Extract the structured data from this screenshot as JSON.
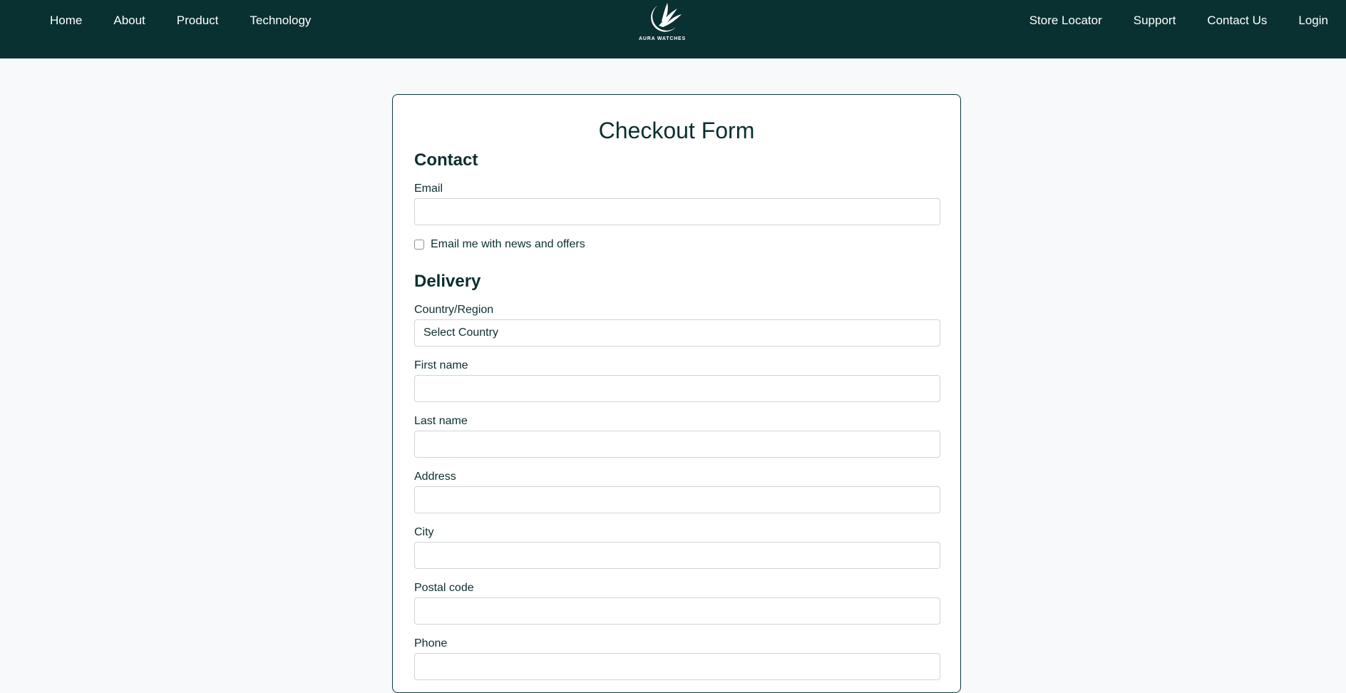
{
  "nav": {
    "left_links": [
      "Home",
      "About",
      "Product",
      "Technology"
    ],
    "right_links": [
      "Store Locator",
      "Support",
      "Contact Us",
      "Login"
    ],
    "logo_text": "AURA WATCHES"
  },
  "form": {
    "title": "Checkout Form",
    "contact_heading": "Contact",
    "email_label": "Email",
    "email_value": "",
    "newsletter_label": "Email me with news and offers",
    "newsletter_checked": false,
    "delivery_heading": "Delivery",
    "country_label": "Country/Region",
    "country_value": "Select Country",
    "first_name_label": "First name",
    "last_name_label": "Last name",
    "address_label": "Address",
    "city_label": "City",
    "postal_label": "Postal code",
    "phone_label": "Phone"
  },
  "colors": {
    "navbar_bg": "#0a3131",
    "page_bg": "#f7f9fa",
    "text": "#0b2f30",
    "card_border": "#0d3a3b"
  },
  "icons": {
    "logo": "moon-wings-logo-icon"
  }
}
